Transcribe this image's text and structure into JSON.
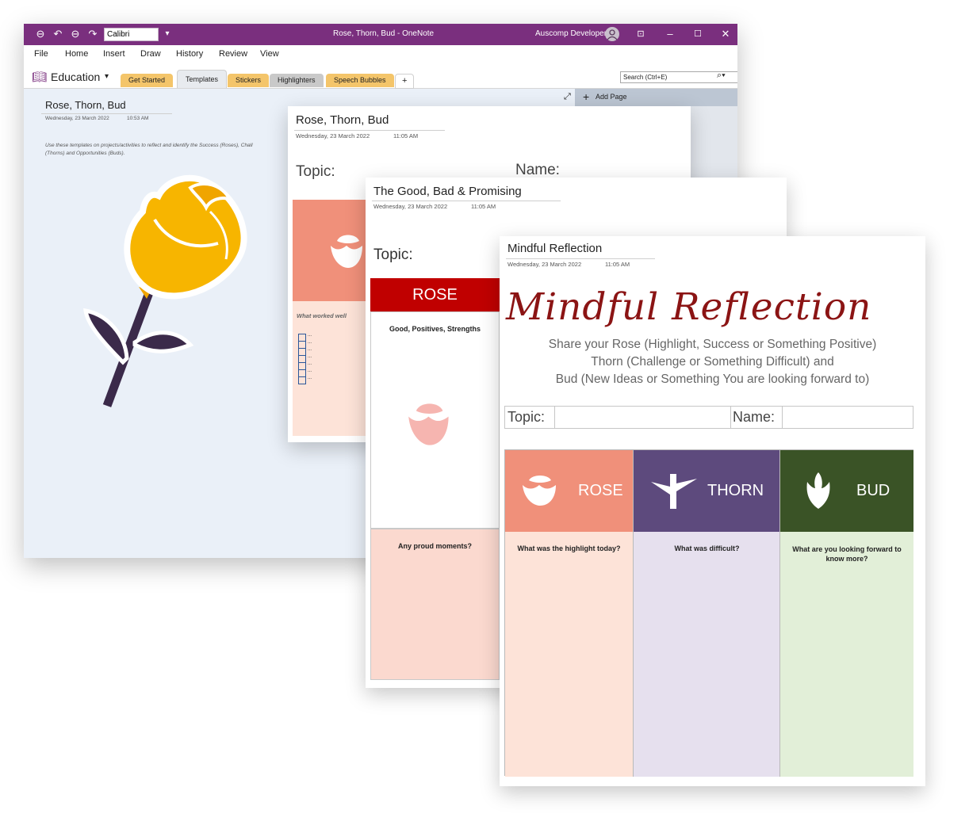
{
  "window": {
    "title": "Rose, Thorn, Bud - OneNote",
    "user": "Auscomp Developer",
    "font_name": "Calibri",
    "menu": [
      "File",
      "Home",
      "Insert",
      "Draw",
      "History",
      "Review",
      "View"
    ],
    "notebook": "Education",
    "sections": [
      "Get Started",
      "Templates",
      "Stickers",
      "Highlighters",
      "Speech Bubbles",
      "+"
    ],
    "search_placeholder": "Search (Ctrl+E)",
    "add_page": "Add Page",
    "page_title": "Rose, Thorn, Bud",
    "page_date": "Wednesday, 23 March 2022",
    "page_time": "10:53 AM",
    "page_body_line1": "Use these templates on projects/activities to reflect and identify the Success (Roses), Chall",
    "page_body_line2": "(Thorns) and Opportunities (Buds)."
  },
  "card1": {
    "title": "Rose, Thorn, Bud",
    "date": "Wednesday, 23 March 2022",
    "time": "11:05 AM",
    "topic_label": "Topic:",
    "name_label": "Name:",
    "prompt": "What worked well",
    "checkbox_mark": "..."
  },
  "card2": {
    "title": "The Good, Bad & Promising",
    "date": "Wednesday, 23 March 2022",
    "time": "11:05 AM",
    "topic_label": "Topic:",
    "rose_header": "ROSE",
    "rose_sub": "Good, Positives, Strengths",
    "proud": "Any proud moments?"
  },
  "card3": {
    "title": "Mindful Reflection",
    "date": "Wednesday, 23 March 2022",
    "time": "11:05 AM",
    "heading": "Mindful Reflection",
    "sub1": "Share your Rose (Highlight, Success or Something Positive)",
    "sub2": "Thorn (Challenge or Something Difficult) and",
    "sub3": "Bud (New Ideas or Something You are looking forward to)",
    "topic_label": "Topic:",
    "name_label": "Name:",
    "columns": [
      {
        "label": "ROSE",
        "question": "What was the highlight today?",
        "head_color": "#f0907a",
        "body_color": "#fde3d8"
      },
      {
        "label": "THORN",
        "question": "What was difficult?",
        "head_color": "#5d4a7d",
        "body_color": "#e6e0ee"
      },
      {
        "label": "BUD",
        "question": "What are you looking forward to know more?",
        "head_color": "#3a5326",
        "body_color": "#e2efd8"
      }
    ]
  }
}
